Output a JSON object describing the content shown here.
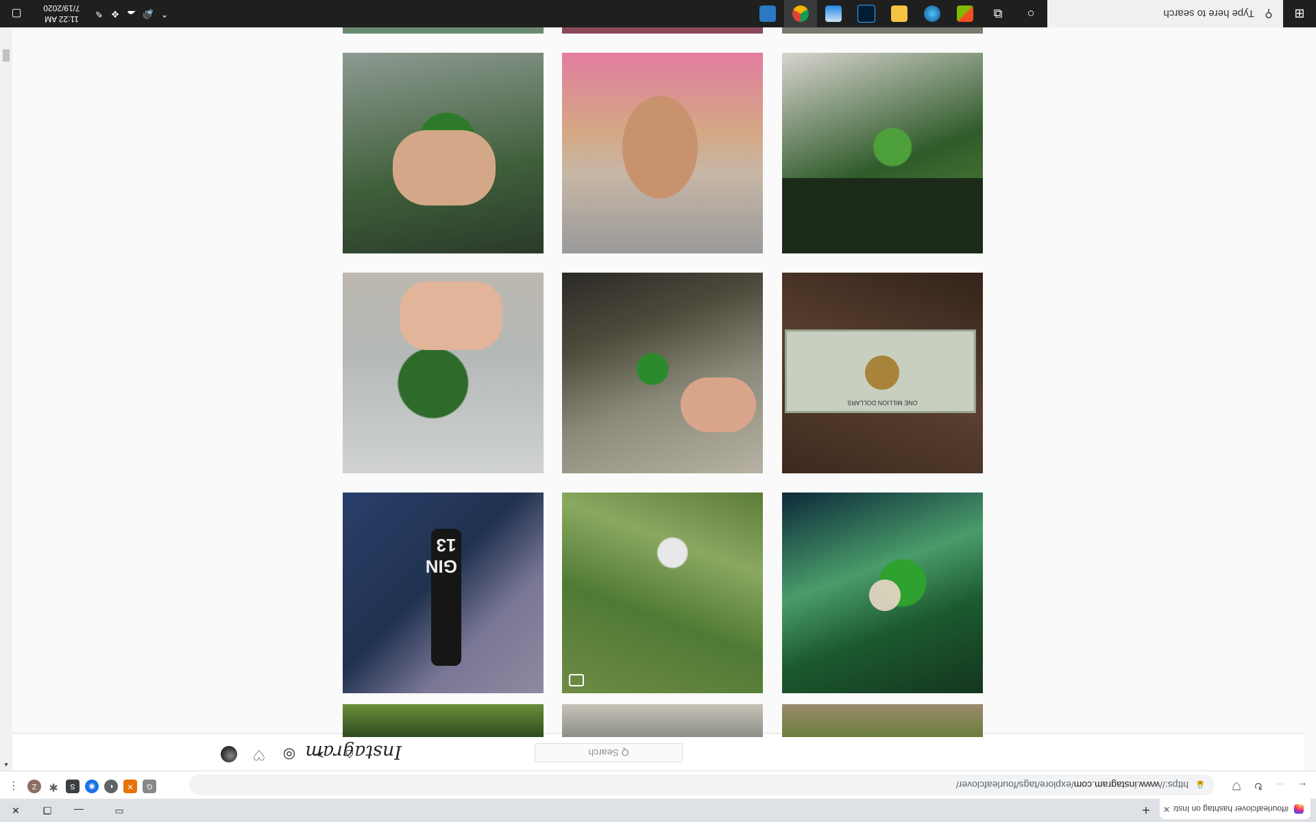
{
  "browser": {
    "tab_title": "#fourleafclover hashtag on Insta",
    "tab_close": "✕",
    "new_tab": "+",
    "win_min": "—",
    "win_max": "❐",
    "win_close": "✕",
    "url_proto": "https://",
    "url_host": "www.instagram.com",
    "url_path": "/explore/tags/fourleafclover/",
    "ext_profile": "Z"
  },
  "instagram": {
    "logo": "Instagram",
    "search_placeholder": "Q Search"
  },
  "taskbar": {
    "search_placeholder": "Type here to search",
    "time": "11:22 AM",
    "date": "7/19/2020"
  },
  "colors": {
    "ig_border": "#dbdbdb",
    "taskbar_bg": "#1f1f1f",
    "chrome_tabstrip": "#dee1e6"
  },
  "grid_posts": [
    {
      "subject": "partial-top-row"
    },
    {
      "subject": "partial-top-row"
    },
    {
      "subject": "partial-top-row"
    },
    {
      "subject": "hand-holding-four-leaf-clover"
    },
    {
      "subject": "hand-picking-clover-in-grass"
    },
    {
      "subject": "gin-bottle-with-clover",
      "text": "GIN 13"
    },
    {
      "subject": "hand-holding-several-clovers-on-concrete"
    },
    {
      "subject": "hand-touching-clover-on-stone"
    },
    {
      "subject": "one-million-dollar-bill-with-clover",
      "text": "ONE MILLION DOLLARS"
    },
    {
      "subject": "four-leaf-clover-held-over-rock"
    },
    {
      "subject": "person-selfie"
    },
    {
      "subject": "clover-on-black-leather-bag"
    }
  ]
}
